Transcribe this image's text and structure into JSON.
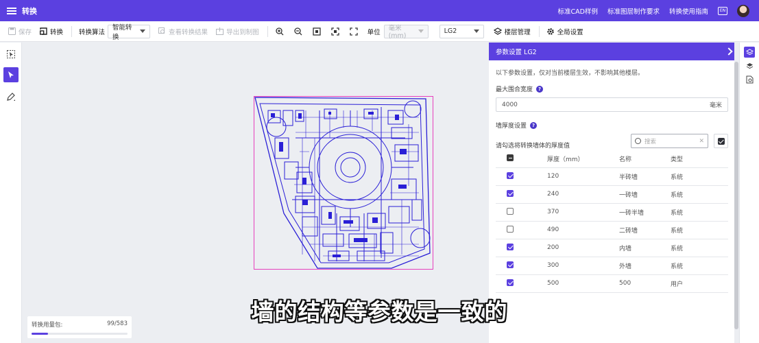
{
  "header": {
    "title": "转换",
    "links": [
      "标准CAD样例",
      "标准图层制作要求",
      "转换使用指南"
    ]
  },
  "toolbar": {
    "save": "保存",
    "convert": "转换",
    "algo_label": "转换算法",
    "algo_value": "智能转换",
    "view_result": "查看转换结果",
    "export": "导出到制图",
    "unit_label": "单位",
    "unit_value": "毫米(mm)",
    "layer_value": "LG2",
    "layer_manage": "楼层管理",
    "global_settings": "全局设置"
  },
  "panel": {
    "title": "参数设置 LG2",
    "description": "以下参数设置，仅对当前楼层生效，不影响其他楼层。",
    "max_width_label": "最大围合宽度",
    "max_width_value": "4000",
    "max_width_unit": "毫米",
    "thickness_label": "墙厚度设置",
    "select_hint": "请勾选将转换墙体的厚度值",
    "search_placeholder": "搜索",
    "columns": [
      "厚度（mm）",
      "名称",
      "类型"
    ],
    "rows": [
      {
        "thickness": "120",
        "name": "半砖墙",
        "type": "系统",
        "checked": true
      },
      {
        "thickness": "240",
        "name": "一砖墙",
        "type": "系统",
        "checked": true
      },
      {
        "thickness": "370",
        "name": "一砖半墙",
        "type": "系统",
        "checked": false
      },
      {
        "thickness": "490",
        "name": "二砖墙",
        "type": "系统",
        "checked": false
      },
      {
        "thickness": "200",
        "name": "内墙",
        "type": "系统",
        "checked": true
      },
      {
        "thickness": "300",
        "name": "外墙",
        "type": "系统",
        "checked": true
      },
      {
        "thickness": "500",
        "name": "500",
        "type": "用户",
        "checked": true
      }
    ]
  },
  "usage": {
    "label": "转换用量包:",
    "value": "99/583",
    "used": 99,
    "total": 583
  },
  "subtitle": "墙的结构等参数是一致的",
  "colors": {
    "accent": "#5b40e0",
    "plan_line": "#2a1fd6",
    "plan_border": "#e63fbd"
  }
}
